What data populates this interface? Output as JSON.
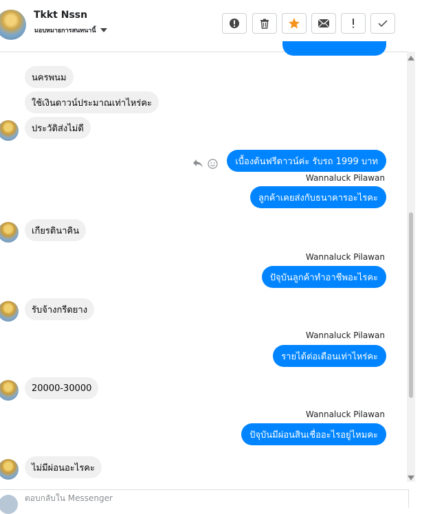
{
  "header": {
    "contact_name": "Tkkt Nssn",
    "assign_label": "มอบหมายการสนทนานี้",
    "buttons": [
      {
        "icon": "alert-circle-icon",
        "label": "mark as spam"
      },
      {
        "icon": "trash-icon",
        "label": "delete"
      },
      {
        "icon": "star-icon",
        "label": "star"
      },
      {
        "icon": "mail-icon",
        "label": "mark unread"
      },
      {
        "icon": "exclamation-icon",
        "label": "follow up"
      },
      {
        "icon": "check-icon",
        "label": "done"
      }
    ],
    "star_color": "#f5921b"
  },
  "messages": {
    "in_1": "นครพนม",
    "in_2": "ใช้เงินดาวน์ประมาณเท่าไหร่คะ",
    "in_3": "ประวัติส่งไม่ดี",
    "out_1": "เบื้องต้นฟรีดาวน์ค่ะ รับรถ 1999 บาท",
    "sender_1": "Wannaluck Pilawan",
    "out_2": "ลูกค้าเคยส่งกับธนาคารอะไรคะ",
    "in_4": "เกียรตินาคิน",
    "sender_2": "Wannaluck Pilawan",
    "out_3": "ปัจุบันลูกค้าทำอาชีพอะไรคะ",
    "in_5": "รับจ้างกรีดยาง",
    "sender_3": "Wannaluck Pilawan",
    "out_4": "รายได้ต่อเดือนเท่าไหร่คะ",
    "in_6": "20000-30000",
    "sender_4": "Wannaluck Pilawan",
    "out_5": "ปัจุบันมีผ่อนสินเชื่ออะไรอยู่ไหมคะ",
    "in_7": "ไม่มีผ่อนอะไรคะ"
  },
  "composer": {
    "placeholder": "ตอบกลับใน Messenger"
  },
  "colors": {
    "outgoing_bubble": "#0084ff",
    "incoming_bubble": "#f0f0f0"
  }
}
